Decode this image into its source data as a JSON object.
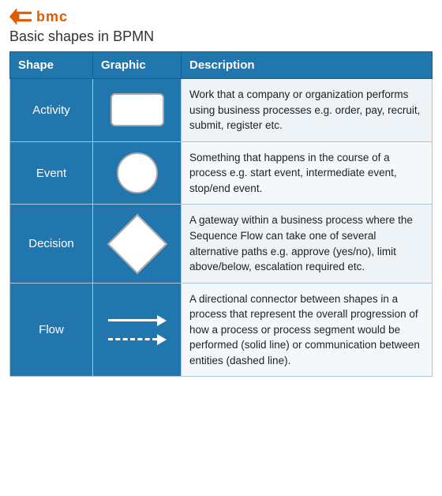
{
  "brand": {
    "logo_text": "bmc",
    "page_title": "Basic shapes in BPMN"
  },
  "table": {
    "headers": [
      "Shape",
      "Graphic",
      "Description"
    ],
    "rows": [
      {
        "shape": "Activity",
        "description": "Work that a company or organization performs using business processes e.g. order, pay, recruit, submit, register etc."
      },
      {
        "shape": "Event",
        "description": "Something that happens in the course of a process e.g. start event, intermediate event, stop/end event."
      },
      {
        "shape": "Decision",
        "description": "A gateway within a business process where the Sequence Flow can take one of several alternative paths e.g. approve (yes/no), limit above/below, escalation required etc."
      },
      {
        "shape": "Flow",
        "description": "A directional connector between shapes in a process that represent the overall progression of how a process or process segment would be performed (solid line) or communication between entities (dashed line)."
      }
    ]
  }
}
